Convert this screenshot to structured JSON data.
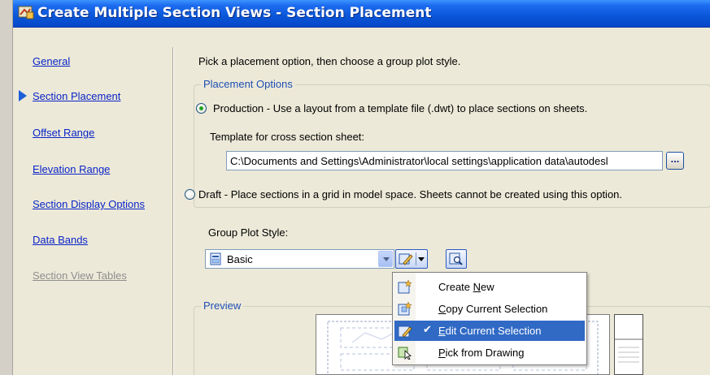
{
  "window": {
    "title": "Create Multiple Section Views - Section Placement"
  },
  "nav": {
    "items": [
      {
        "label": "General",
        "current": false,
        "enabled": true
      },
      {
        "label": "Section Placement",
        "current": true,
        "enabled": true
      },
      {
        "label": "Offset Range",
        "current": false,
        "enabled": true
      },
      {
        "label": "Elevation Range",
        "current": false,
        "enabled": true
      },
      {
        "label": "Section Display Options",
        "current": false,
        "enabled": true
      },
      {
        "label": "Data Bands",
        "current": false,
        "enabled": true
      },
      {
        "label": "Section View Tables",
        "current": false,
        "enabled": false
      }
    ]
  },
  "content": {
    "instruction": "Pick a placement option, then choose a group plot style.",
    "placement_options": {
      "title": "Placement Options",
      "production_label": "Production - Use a layout from a template file (.dwt) to place sections on sheets.",
      "production_selected": true,
      "template_label": "Template for cross section sheet:",
      "template_path": "C:\\Documents and Settings\\Administrator\\local settings\\application data\\autodesl",
      "browse_label": "...",
      "draft_label": "Draft - Place sections in a grid in model space. Sheets cannot be created using this option.",
      "draft_selected": false
    },
    "group_plot_style": {
      "label": "Group Plot Style:",
      "selected": "Basic"
    },
    "preview": {
      "title": "Preview"
    }
  },
  "menu": {
    "items": [
      {
        "label": "Create New",
        "accel": "N",
        "checked": false,
        "highlighted": false
      },
      {
        "label": "Copy Current Selection",
        "accel": "C",
        "checked": false,
        "highlighted": false
      },
      {
        "label": "Edit Current Selection",
        "accel": "E",
        "checked": true,
        "highlighted": true
      },
      {
        "label": "Pick from Drawing",
        "accel": "P",
        "checked": false,
        "highlighted": false
      }
    ],
    "check_glyph": "✔"
  },
  "colors": {
    "titlebar": "#0a56d8",
    "link": "#0a24c8",
    "group_title": "#1f4fb4",
    "menu_highlight": "#316ac5"
  }
}
